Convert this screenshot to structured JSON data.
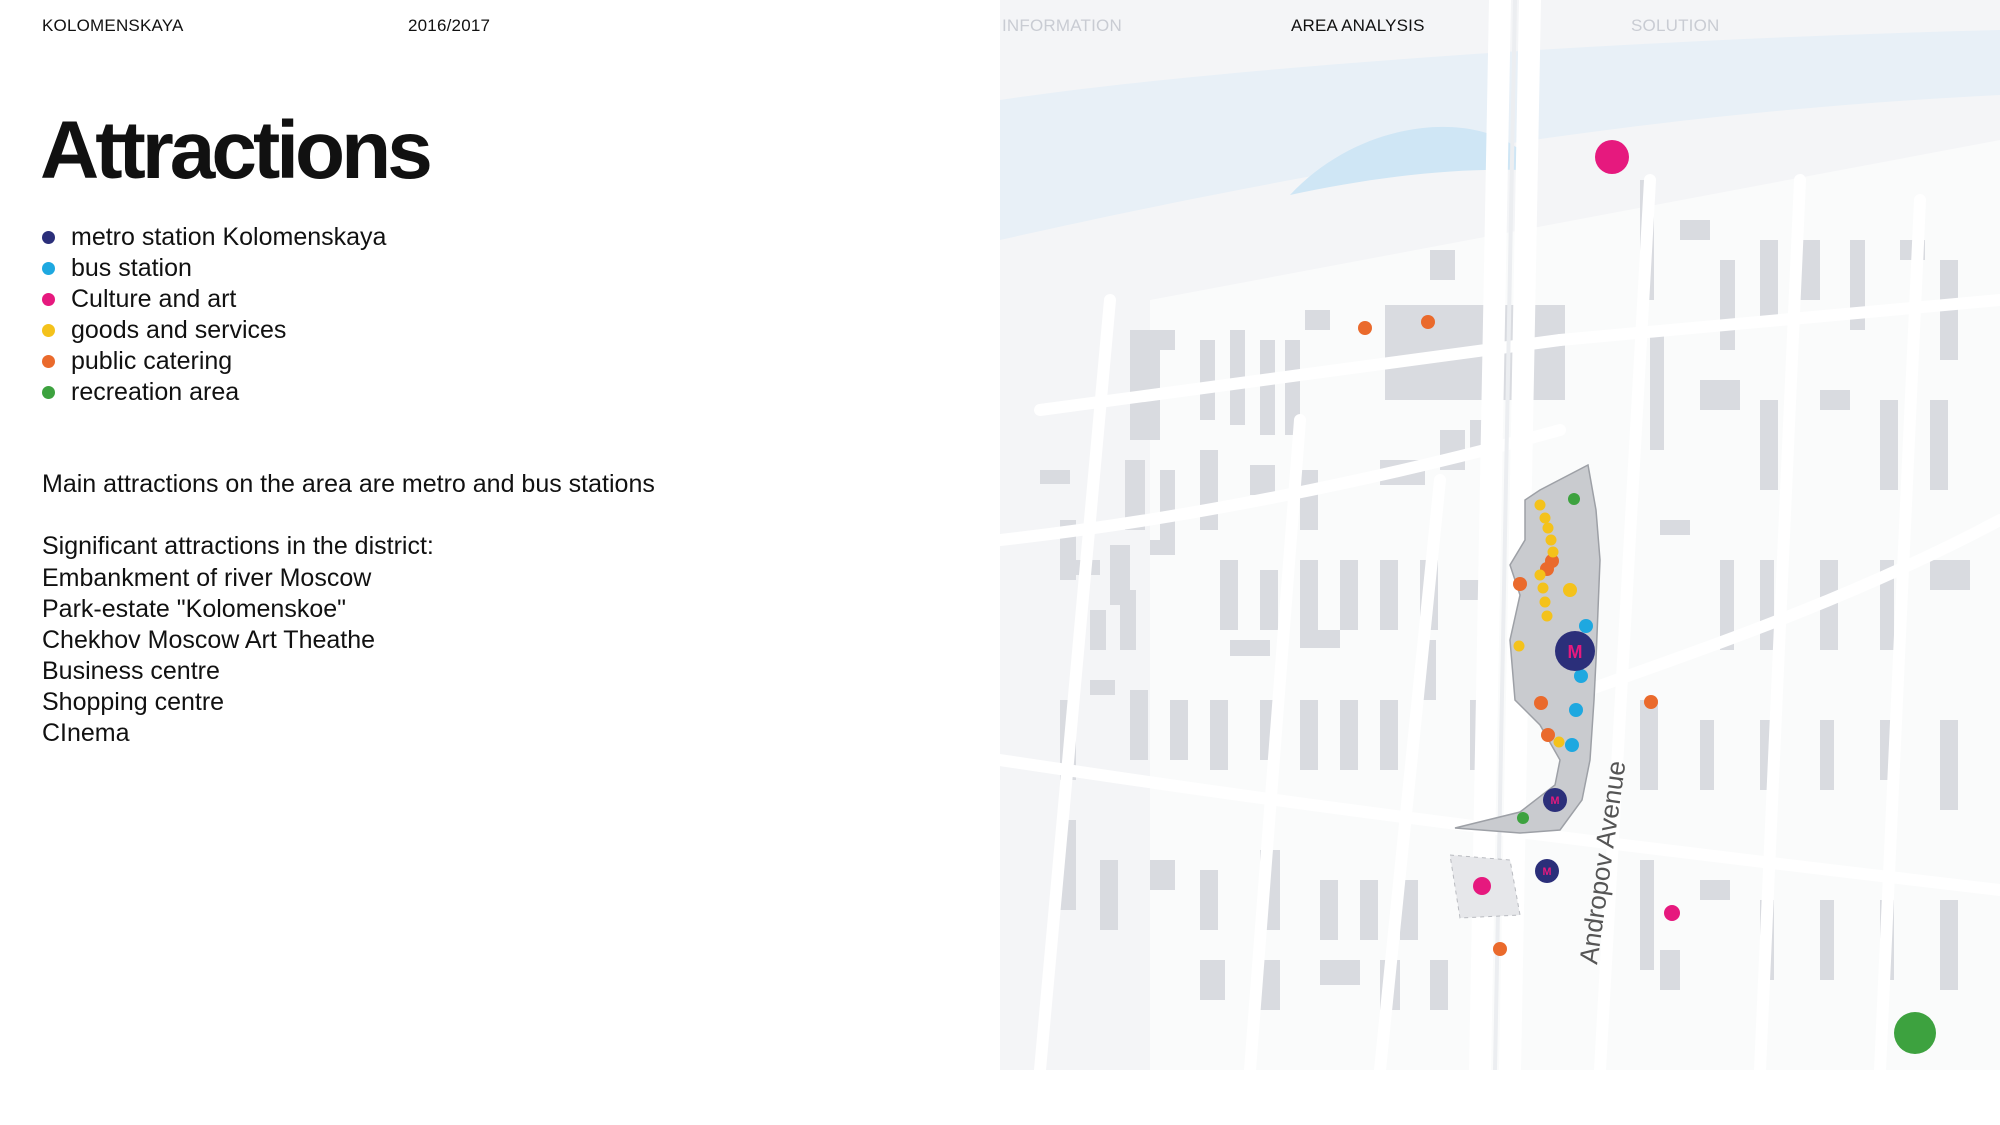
{
  "header": {
    "project": "KOLOMENSKAYA",
    "year": "2016/2017",
    "tabs": [
      {
        "label": "INFORMATION",
        "active": false
      },
      {
        "label": "AREA ANALYSIS",
        "active": true
      },
      {
        "label": "SOLUTION",
        "active": false
      }
    ]
  },
  "title": "Attractions",
  "legend": [
    {
      "label": "metro station Kolomenskaya",
      "color": "#2b2f7a"
    },
    {
      "label": "bus station",
      "color": "#1ea8e0"
    },
    {
      "label": "Culture and art",
      "color": "#e6197e"
    },
    {
      "label": "goods and services",
      "color": "#f4c21b"
    },
    {
      "label": "public catering",
      "color": "#ea6a2c"
    },
    {
      "label": "recreation area",
      "color": "#3da23f"
    }
  ],
  "summary": "Main attractions on the area are metro and bus stations",
  "significant": {
    "title": "Significant attractions in the district:",
    "items": [
      "Embankment of river Moscow",
      "Park-estate \"Kolomenskoe\"",
      "Chekhov Moscow Art Theathe",
      "Business centre",
      "Shopping centre",
      "CInema"
    ]
  },
  "map": {
    "street_label": "Andropov Avenue",
    "metro_letter": "M",
    "colors": {
      "water": "#cfe6f5",
      "street": "#eceef1",
      "building": "#d9dbe0",
      "zone": "#c9cbcf"
    }
  }
}
